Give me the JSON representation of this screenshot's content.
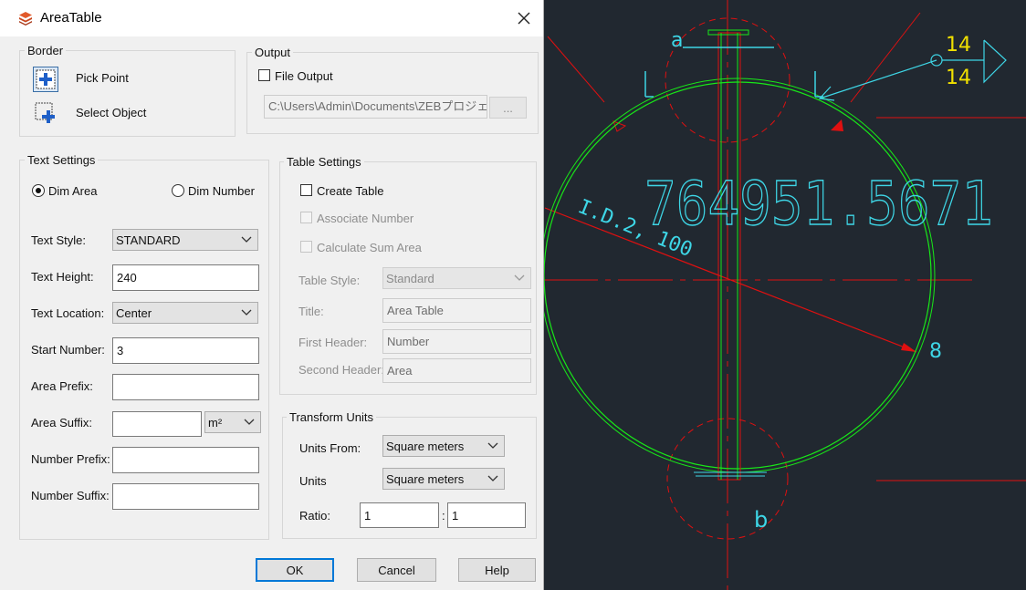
{
  "dialog": {
    "title": "AreaTable",
    "border": {
      "label": "Border",
      "pick_point": "Pick Point",
      "select_object": "Select Object"
    },
    "output": {
      "label": "Output",
      "file_output": "File Output",
      "file_output_checked": false,
      "path": "C:\\Users\\Admin\\Documents\\ZEBプロジェク",
      "browse": "..."
    },
    "text_settings": {
      "label": "Text Settings",
      "dim_area": "Dim Area",
      "dim_number": "Dim Number",
      "selected": "Dim Area",
      "text_style_label": "Text Style:",
      "text_style": "STANDARD",
      "text_height_label": "Text Height:",
      "text_height": "240",
      "text_location_label": "Text Location:",
      "text_location": "Center",
      "start_number_label": "Start Number:",
      "start_number": "3",
      "area_prefix_label": "Area Prefix:",
      "area_prefix": "",
      "area_suffix_label": "Area Suffix:",
      "area_suffix": "",
      "area_unit": "m²",
      "number_prefix_label": "Number Prefix:",
      "number_prefix": "",
      "number_suffix_label": "Number Suffix:",
      "number_suffix": ""
    },
    "table_settings": {
      "label": "Table Settings",
      "create_table": "Create Table",
      "associate_number": "Associate Number",
      "calculate_sum_area": "Calculate Sum Area",
      "table_style_label": "Table Style:",
      "table_style": "Standard",
      "title_label": "Title:",
      "title": "Area Table",
      "first_header_label": "First Header:",
      "first_header": "Number",
      "second_header_label": "Second Header:",
      "second_header": "Area"
    },
    "transform_units": {
      "label": "Transform Units",
      "units_from_label": "Units From:",
      "units_from": "Square meters",
      "units_label": "Units",
      "units": "Square meters",
      "ratio_label": "Ratio:",
      "ratio_left": "1",
      "ratio_sep": ":",
      "ratio_right": "1"
    },
    "buttons": {
      "ok": "OK",
      "cancel": "Cancel",
      "help": "Help"
    }
  },
  "cad": {
    "dimension_text": "764951.5671",
    "diameter_text": "I.D.2, 100",
    "point_a": "a",
    "point_b": "b",
    "number_8": "8",
    "tag_top": "14",
    "tag_bottom": "14",
    "colors": {
      "background": "#212830",
      "red": "#e01010",
      "green": "#18e818",
      "cyan": "#3ed6e6",
      "yellow": "#f0e000",
      "white": "#ffffff"
    }
  }
}
